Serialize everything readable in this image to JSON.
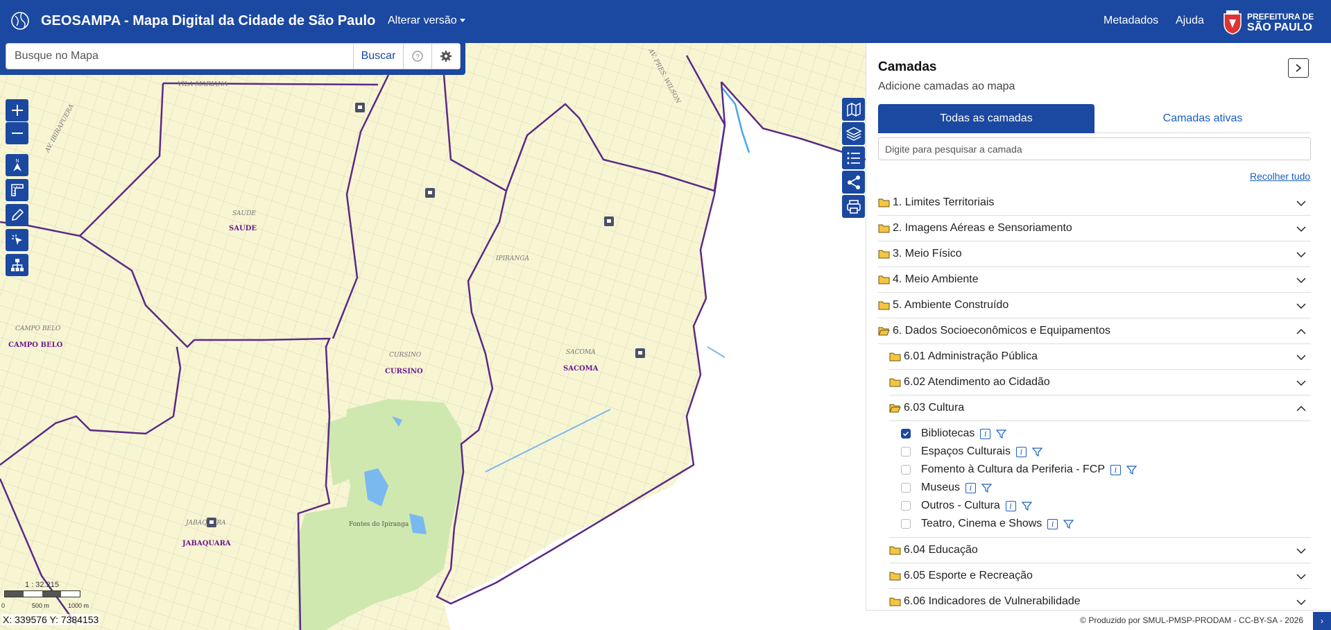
{
  "header": {
    "title": "GEOSAMPA - Mapa Digital da Cidade de São Paulo",
    "version_label": "Alterar versão",
    "links": [
      "Metadados",
      "Ajuda"
    ],
    "prefeitura_line1": "PREFEITURA DE",
    "prefeitura_line2": "SÃO PAULO",
    "brand_color": "#1b48a0"
  },
  "search": {
    "placeholder": "Busque no Mapa",
    "button_label": "Buscar"
  },
  "map": {
    "districts": [
      "SAUDE",
      "CAMPO BELO",
      "CURSINO",
      "SACOMA",
      "JABAQUARA",
      "IPIRANGA"
    ],
    "small_labels": [
      "VILA MARIANA",
      "AV. IBIRAPUERA",
      "AV. PRES. WILSON",
      "SAUDE",
      "CAMPO BELO",
      "CURSINO",
      "SACOMA",
      "JABAQUARA"
    ],
    "park_label": "Fontes do Ipiranga",
    "scale_text": "1 : 32.215",
    "scale_ticks": [
      "0",
      "500 m",
      "1000 m"
    ],
    "coordinates": "X: 339576 Y: 7384153",
    "icons": [
      "library-marker-icon"
    ]
  },
  "panel": {
    "title": "Camadas",
    "subtitle": "Adicione camadas ao mapa",
    "tabs": [
      "Todas as camadas",
      "Camadas ativas"
    ],
    "search_placeholder": "Digite para pesquisar a camada",
    "collapse_all": "Recolher tudo",
    "categories": [
      {
        "label": "1. Limites Territoriais"
      },
      {
        "label": "2. Imagens Aéreas e Sensoriamento"
      },
      {
        "label": "3. Meio Físico"
      },
      {
        "label": "4. Meio Ambiente"
      },
      {
        "label": "5. Ambiente Construído"
      },
      {
        "label": "6. Dados Socioeconômicos e Equipamentos"
      }
    ],
    "subcategories": [
      {
        "label": "6.01 Administração Pública"
      },
      {
        "label": "6.02 Atendimento ao Cidadão"
      },
      {
        "label": "6.03 Cultura"
      },
      {
        "label": "6.04 Educação"
      },
      {
        "label": "6.05 Esporte e Recreação"
      },
      {
        "label": "6.06 Indicadores de Vulnerabilidade"
      }
    ],
    "layers": [
      {
        "label": "Bibliotecas",
        "checked": true
      },
      {
        "label": "Espaços Culturais",
        "checked": false
      },
      {
        "label": "Fomento à Cultura da Periferia - FCP",
        "checked": false
      },
      {
        "label": "Museus",
        "checked": false
      },
      {
        "label": "Outros - Cultura",
        "checked": false
      },
      {
        "label": "Teatro, Cinema e Shows",
        "checked": false
      }
    ]
  },
  "footer": {
    "text": "© Produzido por SMUL-PMSP-PRODAM - CC-BY-SA - 2026",
    "button": "›"
  }
}
